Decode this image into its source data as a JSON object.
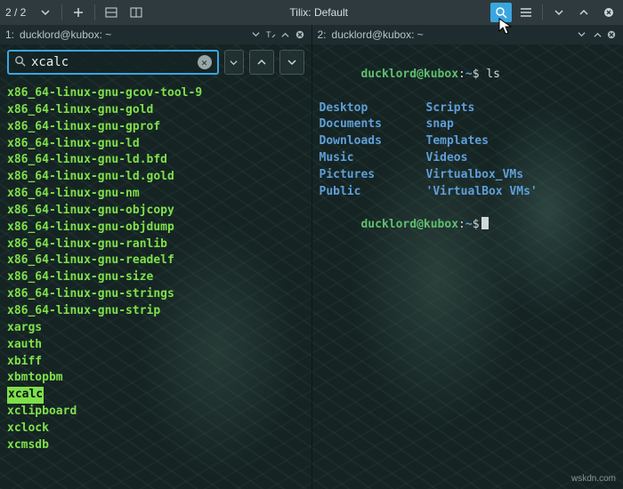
{
  "titlebar": {
    "session_indicator": "2 / 2",
    "title": "Tilix: Default"
  },
  "panes": [
    {
      "index_label": "1:",
      "title": "ducklord@kubox: ~",
      "search": {
        "value": "xcalc",
        "placeholder": ""
      },
      "results": [
        "x86_64-linux-gnu-gcov-tool-9",
        "x86_64-linux-gnu-gold",
        "x86_64-linux-gnu-gprof",
        "x86_64-linux-gnu-ld",
        "x86_64-linux-gnu-ld.bfd",
        "x86_64-linux-gnu-ld.gold",
        "x86_64-linux-gnu-nm",
        "x86_64-linux-gnu-objcopy",
        "x86_64-linux-gnu-objdump",
        "x86_64-linux-gnu-ranlib",
        "x86_64-linux-gnu-readelf",
        "x86_64-linux-gnu-size",
        "x86_64-linux-gnu-strings",
        "x86_64-linux-gnu-strip",
        "xargs",
        "xauth",
        "xbiff",
        "xbmtopbm",
        "xcalc",
        "xclipboard",
        "xclock",
        "xcmsdb"
      ],
      "highlighted_result": "xcalc"
    },
    {
      "index_label": "2:",
      "title": "ducklord@kubox: ~",
      "prompt": {
        "user_host": "ducklord@kubox",
        "sep": ":",
        "path": "~",
        "suffix": "$"
      },
      "command": "ls",
      "ls_output": {
        "left": [
          "Desktop",
          "Documents",
          "Downloads",
          "Music",
          "Pictures",
          "Public"
        ],
        "right": [
          "Scripts",
          "snap",
          "Templates",
          "Videos",
          "Virtualbox_VMs",
          "'VirtualBox VMs'"
        ]
      }
    }
  ],
  "watermark": "wskdn.com"
}
